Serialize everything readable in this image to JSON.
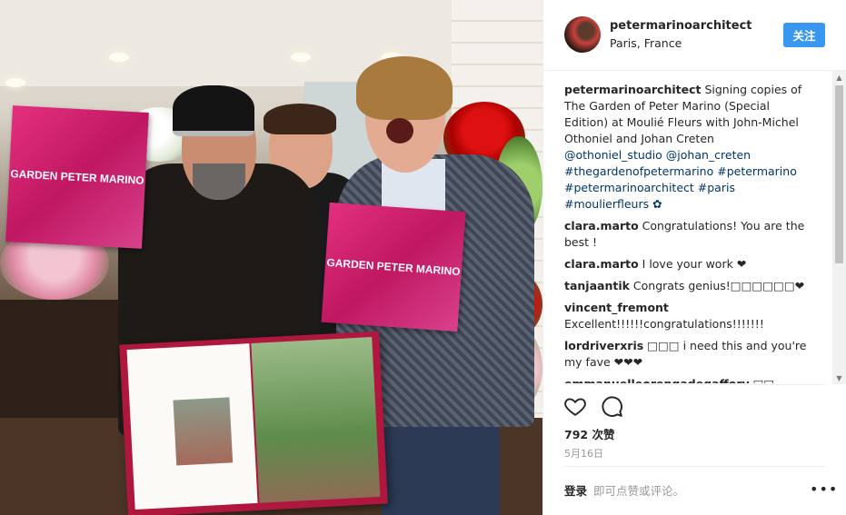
{
  "post": {
    "username": "petermarinoarchitect",
    "location": "Paris, France",
    "follow_label": "关注",
    "book_title": "GARDEN PETER MARINO"
  },
  "comments": [
    {
      "user": "petermarinoarchitect",
      "text": "Signing copies of The Garden of Peter Marino (Special Edition) at Moulié Fleurs with John-Michel Othoniel and Johan Creten",
      "tags": "@othoniel_studio @johan_creten #thegardenofpetermarino #petermarino #petermarinoarchitect #paris #moulierfleurs ✿"
    },
    {
      "user": "clara.marto",
      "text": "Congratulations! You are the best !"
    },
    {
      "user": "clara.marto",
      "text": "I love your work ❤"
    },
    {
      "user": "tanjaantik",
      "text": "Congrats genius!□□□□□□❤"
    },
    {
      "user": "vincent_fremont",
      "text": "Excellent!!!!!!congratulations!!!!!!!"
    },
    {
      "user": "lordriverxris",
      "text": "□□□ i need this and you're my fave ❤❤❤"
    },
    {
      "user": "emmanuelleorengadegaffory",
      "text": "□□"
    }
  ],
  "actions": {
    "likes": "792 次赞",
    "date": "5月16日",
    "login_label": "登录",
    "login_hint": "即可点赞或评论。",
    "more": "•••"
  },
  "icons": {
    "like": "heart-icon",
    "comment": "comment-icon",
    "more": "more-icon"
  },
  "colors": {
    "accent": "#3897f0",
    "link": "#003569",
    "muted": "#999999"
  }
}
